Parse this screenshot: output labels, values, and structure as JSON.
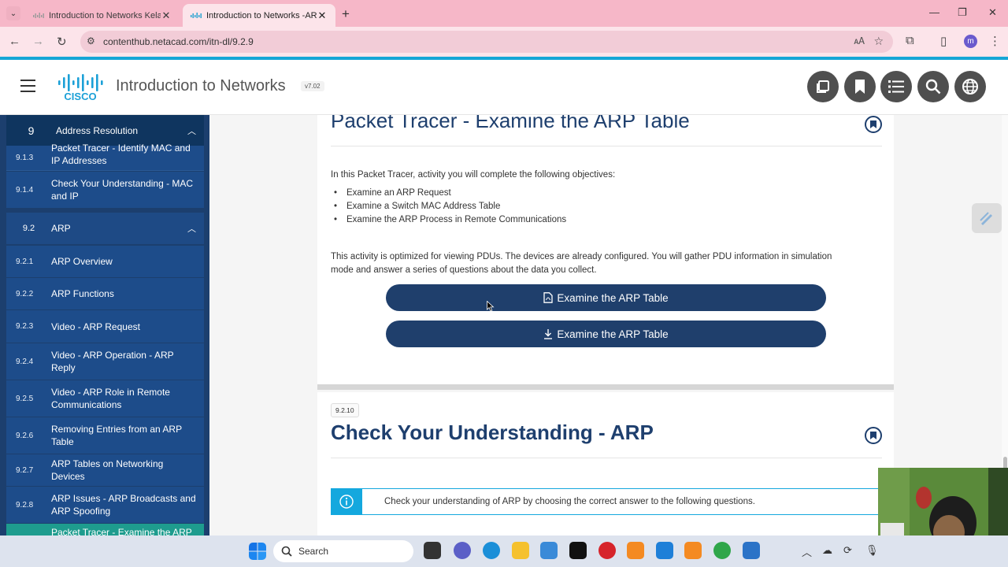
{
  "browser": {
    "tabs": [
      {
        "title": "Introduction to Networks Kelas",
        "active": false
      },
      {
        "title": "Introduction to Networks -ARP",
        "active": true
      }
    ],
    "url": "contenthub.netacad.com/itn-dl/9.2.9",
    "profile_initial": "m"
  },
  "header": {
    "course_title": "Introduction to Networks",
    "version": "v7.02",
    "logo_text": "CISCO"
  },
  "sidebar": {
    "module": {
      "num": "9",
      "label": "Address Resolution"
    },
    "items_top": [
      {
        "num": "9.1.3",
        "label": "Packet Tracer - Identify MAC and IP Addresses"
      },
      {
        "num": "9.1.4",
        "label": "Check Your Understanding - MAC and IP"
      }
    ],
    "section": {
      "num": "9.2",
      "label": "ARP"
    },
    "items": [
      {
        "num": "9.2.1",
        "label": "ARP Overview"
      },
      {
        "num": "9.2.2",
        "label": "ARP Functions"
      },
      {
        "num": "9.2.3",
        "label": "Video - ARP Request"
      },
      {
        "num": "9.2.4",
        "label": "Video - ARP Operation - ARP Reply"
      },
      {
        "num": "9.2.5",
        "label": "Video - ARP Role in Remote Communications"
      },
      {
        "num": "9.2.6",
        "label": "Removing Entries from an ARP Table"
      },
      {
        "num": "9.2.7",
        "label": "ARP Tables on Networking Devices"
      },
      {
        "num": "9.2.8",
        "label": "ARP Issues - ARP Broadcasts and ARP Spoofing"
      },
      {
        "num": "",
        "label": "Packet Tracer - Examine the ARP"
      }
    ]
  },
  "content": {
    "pt_title": "Packet Tracer - Examine the ARP Table",
    "intro": "In this Packet Tracer, activity you will complete the following objectives:",
    "objectives": [
      "Examine an ARP Request",
      "Examine a Switch MAC Address Table",
      "Examine the ARP Process in Remote Communications"
    ],
    "note_line1": "This activity is optimized for viewing PDUs. The devices are already configured. You will gather PDU information in simulation",
    "note_line2": "mode and answer a series of questions about the data you collect.",
    "btn_instructions": "Examine the ARP Table",
    "btn_download": "Examine the ARP Table",
    "cyu_badge": "9.2.10",
    "cyu_title": "Check Your Understanding - ARP",
    "cyu_info": "Check your understanding of ARP by choosing the correct answer to the following questions."
  },
  "taskbar": {
    "search_label": "Search"
  }
}
